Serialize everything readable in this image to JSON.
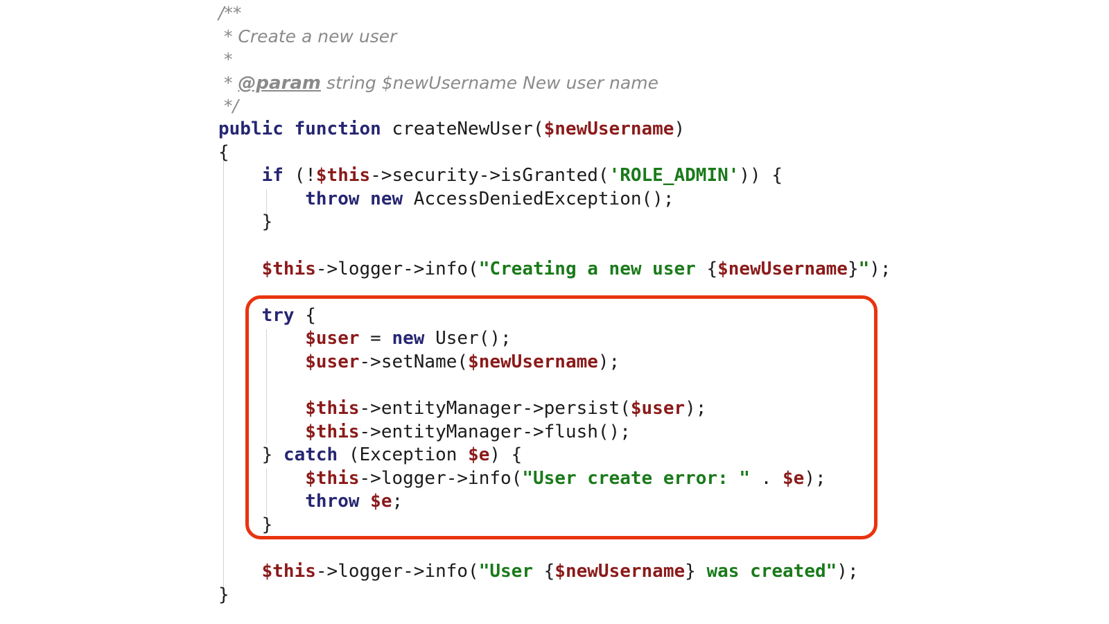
{
  "editor": {
    "language": "PHP",
    "background_color": "#ffffff",
    "font_size_px": 26,
    "line_height_px": 33.6,
    "colors": {
      "keyword": "#262673",
      "variable": "#8b1a1a",
      "string": "#1a7a1a",
      "comment": "#8a8a8a",
      "plain": "#1b1b1b",
      "indent_guide": "#d2d2d2",
      "highlight_border": "#e8340f"
    }
  },
  "highlight": {
    "shape": "rounded-rectangle",
    "border_color": "#e8340f",
    "border_width_px": 5,
    "corner_radius_px": 22,
    "covers_lines": "try { ... } catch (Exception $e) { ... }"
  },
  "code": {
    "lines": [
      {
        "n": 1,
        "indent": 0,
        "tokens": [
          {
            "t": "cmt",
            "v": "/**"
          }
        ]
      },
      {
        "n": 2,
        "indent": 0,
        "tokens": [
          {
            "t": "cmt",
            "v": " * Create a new user"
          }
        ]
      },
      {
        "n": 3,
        "indent": 0,
        "tokens": [
          {
            "t": "cmt",
            "v": " *"
          }
        ]
      },
      {
        "n": 4,
        "indent": 0,
        "tokens": [
          {
            "t": "cmt",
            "v": " * "
          },
          {
            "t": "cmt-tag",
            "v": "@param"
          },
          {
            "t": "cmt",
            "v": " string $newUsername New user name"
          }
        ]
      },
      {
        "n": 5,
        "indent": 0,
        "tokens": [
          {
            "t": "cmt",
            "v": " */"
          }
        ]
      },
      {
        "n": 6,
        "indent": 0,
        "tokens": [
          {
            "t": "kw",
            "v": "public"
          },
          {
            "t": "pln",
            "v": " "
          },
          {
            "t": "kw",
            "v": "function"
          },
          {
            "t": "pln",
            "v": " createNewUser("
          },
          {
            "t": "var",
            "v": "$newUsername"
          },
          {
            "t": "pln",
            "v": ")"
          }
        ]
      },
      {
        "n": 7,
        "indent": 0,
        "tokens": [
          {
            "t": "pln",
            "v": "{"
          }
        ]
      },
      {
        "n": 8,
        "indent": 1,
        "tokens": [
          {
            "t": "kw",
            "v": "if"
          },
          {
            "t": "pln",
            "v": " (!"
          },
          {
            "t": "var",
            "v": "$this"
          },
          {
            "t": "pln",
            "v": "->security->isGranted("
          },
          {
            "t": "str",
            "v": "'ROLE_ADMIN'"
          },
          {
            "t": "pln",
            "v": ")) {"
          }
        ]
      },
      {
        "n": 9,
        "indent": 2,
        "tokens": [
          {
            "t": "kw",
            "v": "throw"
          },
          {
            "t": "pln",
            "v": " "
          },
          {
            "t": "kw",
            "v": "new"
          },
          {
            "t": "pln",
            "v": " AccessDeniedException();"
          }
        ]
      },
      {
        "n": 10,
        "indent": 1,
        "tokens": [
          {
            "t": "pln",
            "v": "}"
          }
        ]
      },
      {
        "n": 11,
        "indent": 0,
        "tokens": []
      },
      {
        "n": 12,
        "indent": 1,
        "tokens": [
          {
            "t": "var",
            "v": "$this"
          },
          {
            "t": "pln",
            "v": "->logger->info("
          },
          {
            "t": "str",
            "v": "\"Creating a new user "
          },
          {
            "t": "pln",
            "v": "{"
          },
          {
            "t": "var",
            "v": "$newUsername"
          },
          {
            "t": "pln",
            "v": "}"
          },
          {
            "t": "str",
            "v": "\""
          },
          {
            "t": "pln",
            "v": ");"
          }
        ]
      },
      {
        "n": 13,
        "indent": 0,
        "tokens": []
      },
      {
        "n": 14,
        "indent": 1,
        "tokens": [
          {
            "t": "kw",
            "v": "try"
          },
          {
            "t": "pln",
            "v": " {"
          }
        ]
      },
      {
        "n": 15,
        "indent": 2,
        "tokens": [
          {
            "t": "var",
            "v": "$user"
          },
          {
            "t": "pln",
            "v": " = "
          },
          {
            "t": "kw",
            "v": "new"
          },
          {
            "t": "pln",
            "v": " User();"
          }
        ]
      },
      {
        "n": 16,
        "indent": 2,
        "tokens": [
          {
            "t": "var",
            "v": "$user"
          },
          {
            "t": "pln",
            "v": "->setName("
          },
          {
            "t": "var",
            "v": "$newUsername"
          },
          {
            "t": "pln",
            "v": ");"
          }
        ]
      },
      {
        "n": 17,
        "indent": 0,
        "tokens": []
      },
      {
        "n": 18,
        "indent": 2,
        "tokens": [
          {
            "t": "var",
            "v": "$this"
          },
          {
            "t": "pln",
            "v": "->entityManager->persist("
          },
          {
            "t": "var",
            "v": "$user"
          },
          {
            "t": "pln",
            "v": ");"
          }
        ]
      },
      {
        "n": 19,
        "indent": 2,
        "tokens": [
          {
            "t": "var",
            "v": "$this"
          },
          {
            "t": "pln",
            "v": "->entityManager->flush();"
          }
        ]
      },
      {
        "n": 20,
        "indent": 1,
        "tokens": [
          {
            "t": "pln",
            "v": "} "
          },
          {
            "t": "kw",
            "v": "catch"
          },
          {
            "t": "pln",
            "v": " (Exception "
          },
          {
            "t": "var",
            "v": "$e"
          },
          {
            "t": "pln",
            "v": ") {"
          }
        ]
      },
      {
        "n": 21,
        "indent": 2,
        "tokens": [
          {
            "t": "var",
            "v": "$this"
          },
          {
            "t": "pln",
            "v": "->logger->info("
          },
          {
            "t": "str",
            "v": "\"User create error: \""
          },
          {
            "t": "pln",
            "v": " . "
          },
          {
            "t": "var",
            "v": "$e"
          },
          {
            "t": "pln",
            "v": ");"
          }
        ]
      },
      {
        "n": 22,
        "indent": 2,
        "tokens": [
          {
            "t": "kw",
            "v": "throw"
          },
          {
            "t": "pln",
            "v": " "
          },
          {
            "t": "var",
            "v": "$e"
          },
          {
            "t": "pln",
            "v": ";"
          }
        ]
      },
      {
        "n": 23,
        "indent": 1,
        "tokens": [
          {
            "t": "pln",
            "v": "}"
          }
        ]
      },
      {
        "n": 24,
        "indent": 0,
        "tokens": []
      },
      {
        "n": 25,
        "indent": 1,
        "tokens": [
          {
            "t": "var",
            "v": "$this"
          },
          {
            "t": "pln",
            "v": "->logger->info("
          },
          {
            "t": "str",
            "v": "\"User "
          },
          {
            "t": "pln",
            "v": "{"
          },
          {
            "t": "var",
            "v": "$newUsername"
          },
          {
            "t": "pln",
            "v": "}"
          },
          {
            "t": "str",
            "v": " was created\""
          },
          {
            "t": "pln",
            "v": ");"
          }
        ]
      },
      {
        "n": 26,
        "indent": 0,
        "tokens": [
          {
            "t": "pln",
            "v": "}"
          }
        ]
      }
    ]
  }
}
